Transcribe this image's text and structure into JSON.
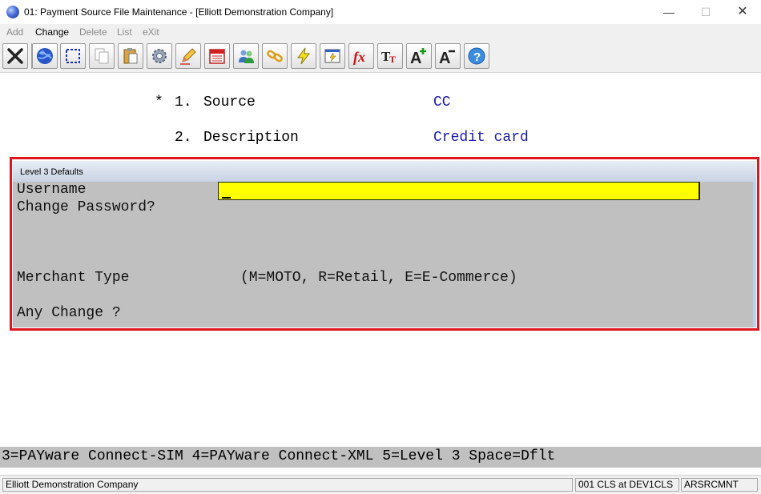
{
  "window": {
    "title": "01: Payment Source File Maintenance - [Elliott Demonstration Company]",
    "minimize": "—",
    "maximize": "☐",
    "close": "✕"
  },
  "menu": [
    {
      "label": "Add",
      "enabled": false
    },
    {
      "label": "Change",
      "enabled": true
    },
    {
      "label": "Delete",
      "enabled": false
    },
    {
      "label": "List",
      "enabled": false
    },
    {
      "label": "eXit",
      "enabled": false
    }
  ],
  "toolbar": {
    "buttons": [
      "close-icon",
      "globe-icon",
      "select-icon",
      "copy-icon",
      "paste-icon",
      "settings-icon",
      "edit-icon",
      "calendar-icon",
      "users-icon",
      "chain-icon",
      "lightning-icon",
      "report-icon",
      "function-icon",
      "font-icon",
      "font-increase-icon",
      "font-decrease-icon",
      "help-icon"
    ]
  },
  "form": {
    "fields": [
      {
        "marker": "*",
        "number": "1.",
        "label": "Source",
        "value": "CC"
      },
      {
        "marker": "",
        "number": "2.",
        "label": "Description",
        "value": "Credit card"
      }
    ]
  },
  "level3": {
    "title": "Level 3 Defaults",
    "username_label": "Username",
    "username_value": "",
    "change_password_label": "Change Password?",
    "merchant_type_label": "Merchant Type",
    "merchant_type_hint": "(M=MOTO, R=Retail, E=E-Commerce)",
    "any_change_label": "Any Change ?"
  },
  "function_keys": "3=PAYware Connect-SIM 4=PAYware Connect-XML 5=Level 3 Space=Dflt",
  "status": {
    "company": "Elliott Demonstration Company",
    "session": "001 CLS at DEV1CLS",
    "program": "ARSRCMNT"
  },
  "colors": {
    "accent_frame": "#e0151e",
    "input_highlight": "#ffff00",
    "value_text": "#1a1ab0",
    "panel_gray": "#c0c0c0"
  }
}
